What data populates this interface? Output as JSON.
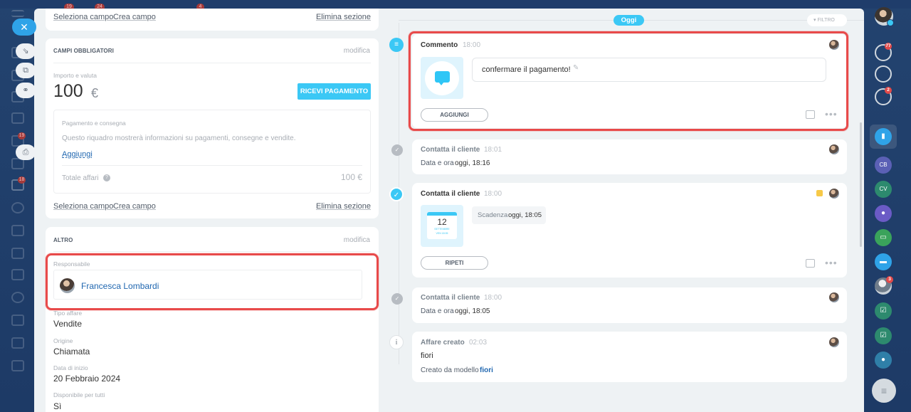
{
  "left_column": {
    "top_links": {
      "select_field": "Seleziona campo",
      "create_field": "Crea campo",
      "delete_section": "Elimina sezione"
    },
    "required": {
      "header": "CAMPI OBBLIGATORI",
      "edit": "modifica",
      "amount_label": "Importo e valuta",
      "amount": "100",
      "currency": "€",
      "receive_payment": "RICEVI PAGAMENTO",
      "payment_box": {
        "title": "Pagamento e consegna",
        "description": "Questo riquadro mostrerà informazioni su pagamenti, consegne e vendite.",
        "add": "Aggiungi",
        "total_label": "Totale affari",
        "total": "100 €"
      },
      "links": {
        "select_field": "Seleziona campo",
        "create_field": "Crea campo",
        "delete_section": "Elimina sezione"
      }
    },
    "other": {
      "header": "ALTRO",
      "edit": "modifica",
      "responsible_label": "Responsabile",
      "responsible_name": "Francesca Lombardi",
      "deal_type_label": "Tipo affare",
      "deal_type": "Vendite",
      "origin_label": "Origine",
      "origin": "Chiamata",
      "start_label": "Data di inizio",
      "start": "20 Febbraio 2024",
      "available_label": "Disponibile per tutti",
      "available": "Sì"
    }
  },
  "timeline": {
    "today": "Oggi",
    "filter": "FILTRO",
    "comment": {
      "title": "Commento",
      "time": "18:00",
      "text": "confermare il pagamento!",
      "add": "AGGIUNGI"
    },
    "call1": {
      "title": "Contatta il cliente",
      "time": "18:01",
      "text_prefix": "Data e ora",
      "text_value": "oggi, 18:16"
    },
    "call2": {
      "title": "Contatta il cliente",
      "time": "18:00",
      "cal_day": "12",
      "cal_month": "SETTEMBRE",
      "cal_dow": "VEN 18:05",
      "deadline_prefix": "Scadenza",
      "deadline_value": "oggi, 18:05",
      "repeat": "RIPETI"
    },
    "call3": {
      "title": "Contatta il cliente",
      "time": "18:00",
      "text_prefix": "Data e ora",
      "text_value": "oggi, 18:05"
    },
    "created": {
      "title": "Affare creato",
      "time": "02:03",
      "name": "fiori",
      "template_prefix": "Creato da modello",
      "template_value": "fiori"
    }
  },
  "right_bar": {
    "notifications_badge": "77",
    "chat_badge": "2",
    "avatar_badge": "3",
    "crm_initials_1": "CB",
    "crm_initials_2": "CV"
  },
  "left_nav": {
    "badge_1": "19",
    "badge_2": "24",
    "badge_3": "4",
    "badge_4": "19",
    "badge_5": "18"
  },
  "colors": {
    "accent": "#3bc8f5",
    "highlight": "#e84a4a",
    "link": "#2067b0"
  }
}
